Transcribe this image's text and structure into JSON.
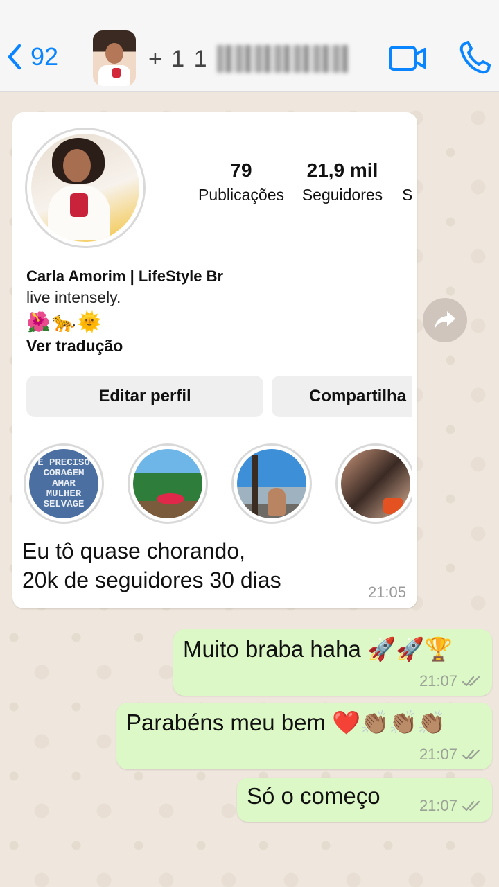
{
  "header": {
    "back_count": "92",
    "contact_prefix": "+ 1 1",
    "accent_color": "#0a84ff"
  },
  "instagram_card": {
    "stats": [
      {
        "value": "79",
        "label": "Publicações"
      },
      {
        "value": "21,9 mil",
        "label": "Seguidores"
      },
      {
        "value": "",
        "label": "S"
      }
    ],
    "name": "Carla Amorim | LifeStyle Br",
    "bio": "live intensely.",
    "emojis": "🌺🐆🌞",
    "translate_label": "Ver tradução",
    "edit_button": "Editar perfil",
    "share_button": "Compartilha",
    "highlight_1_lines": [
      "É PRECISO",
      "CORAGEM",
      "AMAR",
      "MULHER",
      "SELVAGE"
    ]
  },
  "incoming": {
    "line1": "Eu tô quase chorando,",
    "line2": "20k de seguidores 30 dias",
    "time": "21:05"
  },
  "outgoing": [
    {
      "text": "Muito braba haha 🚀🚀🏆",
      "time": "21:07"
    },
    {
      "text": "Parabéns meu bem ❤️👏🏽👏🏽👏🏽",
      "time": "21:07"
    },
    {
      "text": "Só o começo",
      "time": "21:07"
    }
  ],
  "icons": {
    "back": "chevron-left-icon",
    "video": "video-camera-icon",
    "phone": "phone-icon",
    "forward": "forward-arrow-icon",
    "read": "double-check-icon"
  }
}
